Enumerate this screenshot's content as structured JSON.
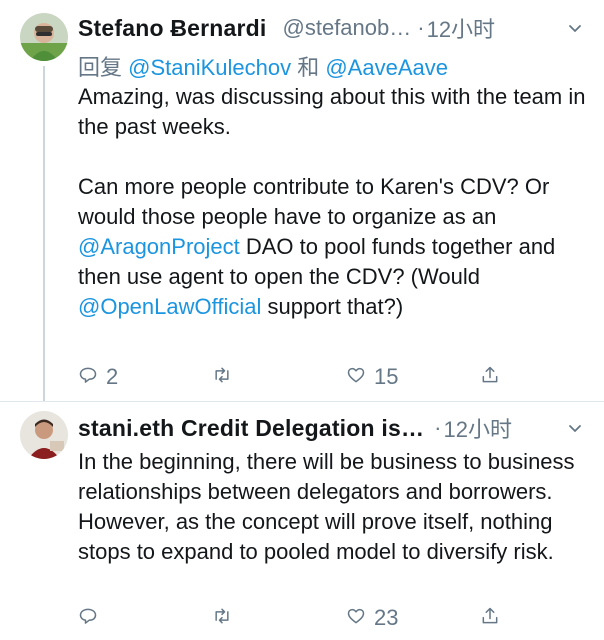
{
  "tweets": [
    {
      "author_name": "Stefano Ƀernardi",
      "handle": "@stefanob…",
      "separator": "·",
      "time": "12小时",
      "replying": {
        "prefix": "回复 ",
        "user1": "@StaniKulechov",
        "joiner": " 和 ",
        "user2": "@AaveAave"
      },
      "body": {
        "part1": "Amazing, was discussing about this with the team in the past weeks.\n\nCan more people contribute to Karen's CDV? Or would those people have to organize as an ",
        "mention1": "@AragonProject",
        "part2": " DAO to pool funds together and then use agent to open the CDV? (Would ",
        "mention2": "@OpenLawOfficial",
        "part3": " support that?)"
      },
      "actions": {
        "replies": "2",
        "retweets": "",
        "likes": "15"
      }
    },
    {
      "author_name": "stani.eth Credit Delegation is…",
      "separator": "·",
      "time": "12小时",
      "body": "In the beginning, there will be business to business relationships between delegators and borrowers. However, as the concept will prove itself, nothing stops to expand to pooled model to diversify risk.",
      "actions": {
        "replies": "",
        "retweets": "",
        "likes": "23"
      }
    }
  ],
  "icons": {
    "reply": "reply-icon",
    "retweet": "retweet-icon",
    "like": "heart-icon",
    "share": "share-icon",
    "more": "chevron-down-icon"
  },
  "colors": {
    "text": "#14171a",
    "secondary": "#657786",
    "link": "#1b95e0",
    "divider": "#e1e8ed",
    "thread_line": "#ccd6dd"
  }
}
